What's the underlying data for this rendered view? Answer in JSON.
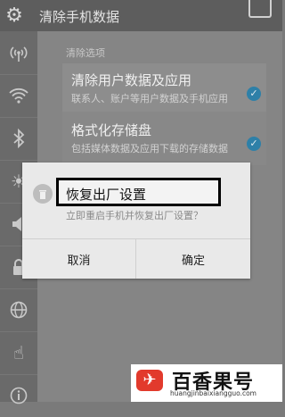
{
  "topbar": {
    "title": "清除手机数据"
  },
  "sidebar": {
    "icons": [
      "antenna-icon",
      "wifi-icon",
      "bluetooth-icon",
      "brightness-icon",
      "volume-icon",
      "lock-icon",
      "globe-icon",
      "gesture-hand-icon",
      "info-icon"
    ]
  },
  "section": {
    "heading": "清除选项"
  },
  "options": [
    {
      "title": "清除用户数据及应用",
      "subtitle": "联系人、账户等用户数据及手机应用",
      "checked": true
    },
    {
      "title": "格式化存储盘",
      "subtitle": "包括媒体数据及应用下载的存储数据",
      "checked": true
    }
  ],
  "dialog": {
    "title": "恢复出厂设置",
    "message": "立即重启手机并恢复出厂设置？",
    "cancel_label": "取消",
    "ok_label": "确定"
  },
  "watermark": {
    "brand": "百香果号",
    "url": "huangjinbaixiangguo.com"
  },
  "colors": {
    "accent": "#2e80a8",
    "highlight_border": "#000000",
    "logo_red": "#e23a2c"
  }
}
